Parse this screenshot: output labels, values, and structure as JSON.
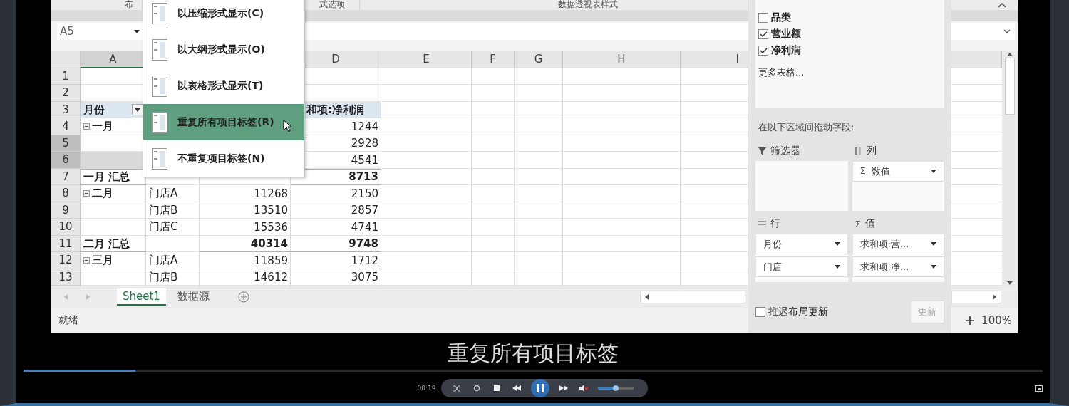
{
  "ribbon": {
    "groups": [
      "布",
      "式选项",
      "数据透视表样式"
    ]
  },
  "formula_bar": {
    "name_box": "A5"
  },
  "columns": [
    {
      "label": "A",
      "selected": true
    },
    {
      "label": "D",
      "selected": false
    },
    {
      "label": "E",
      "selected": false
    },
    {
      "label": "F",
      "selected": false
    },
    {
      "label": "G",
      "selected": false
    },
    {
      "label": "H",
      "selected": false
    },
    {
      "label": "I",
      "selected": false
    }
  ],
  "rows": [
    {
      "num": "1",
      "kind": "blank",
      "selected": false
    },
    {
      "num": "2",
      "kind": "blank",
      "selected": false
    },
    {
      "num": "3",
      "kind": "header",
      "selected": false,
      "a": "月份",
      "d": "和项:净利润"
    },
    {
      "num": "4",
      "kind": "group",
      "selected": false,
      "a": "一月",
      "d": "1244"
    },
    {
      "num": "5",
      "kind": "item",
      "selected": true,
      "d": "2928"
    },
    {
      "num": "6",
      "kind": "item",
      "selected": true,
      "d": "4541"
    },
    {
      "num": "7",
      "kind": "subtotal",
      "selected": false,
      "a": "一月 汇总",
      "d": "8713"
    },
    {
      "num": "8",
      "kind": "group",
      "selected": false,
      "a": "二月",
      "b": "门店A",
      "c": "11268",
      "d": "2150"
    },
    {
      "num": "9",
      "kind": "item",
      "selected": false,
      "b": "门店B",
      "c": "13510",
      "d": "2857"
    },
    {
      "num": "10",
      "kind": "item",
      "selected": false,
      "b": "门店C",
      "c": "15536",
      "d": "4741"
    },
    {
      "num": "11",
      "kind": "subtotal",
      "selected": false,
      "a": "二月 汇总",
      "c": "40314",
      "d": "9748"
    },
    {
      "num": "12",
      "kind": "group",
      "selected": false,
      "a": "三月",
      "b": "门店A",
      "c": "11859",
      "d": "1712"
    },
    {
      "num": "13",
      "kind": "item",
      "selected": false,
      "b": "门店B",
      "c": "14612",
      "d": "3075"
    }
  ],
  "sheet_tabs": [
    {
      "label": "Sheet1",
      "selected": true
    },
    {
      "label": "数据源",
      "selected": false
    }
  ],
  "status_bar": {
    "status": "就绪",
    "zoom": "100%"
  },
  "layout_menu": [
    {
      "label": "以压缩形式显示(C)",
      "selected": false
    },
    {
      "label": "以大纲形式显示(O)",
      "selected": false
    },
    {
      "label": "以表格形式显示(T)",
      "selected": false
    },
    {
      "label": "重复所有项目标签(R)",
      "selected": true
    },
    {
      "label": "不重复项目标签(N)",
      "selected": false
    }
  ],
  "pivot_panel": {
    "fields": [
      {
        "label": "品类",
        "checked": false
      },
      {
        "label": "营业额",
        "checked": true
      },
      {
        "label": "净利润",
        "checked": true
      }
    ],
    "more_link": "更多表格...",
    "drag_hint": "在以下区域间拖动字段:",
    "areas": [
      {
        "kind": "filter",
        "title": "筛选器"
      },
      {
        "kind": "columns",
        "title": "列",
        "items": [
          {
            "symbol": "Σ",
            "label": "数值"
          }
        ]
      },
      {
        "kind": "rows",
        "title": "行",
        "items": [
          {
            "label": "月份"
          },
          {
            "label": "门店"
          }
        ]
      },
      {
        "kind": "values",
        "symbol": "Σ",
        "title": "值",
        "items": [
          {
            "label": "求和项:营..."
          },
          {
            "label": "求和项:净..."
          }
        ]
      }
    ],
    "defer": {
      "label": "推迟布局更新",
      "checked": false
    },
    "update_button": {
      "label": "更新",
      "disabled": true
    }
  },
  "player": {
    "subtitle": "重复所有项目标签",
    "progress": {
      "level": 0.11
    },
    "time": "00:19",
    "volume": {
      "level": 0.5
    },
    "muted": true
  }
}
